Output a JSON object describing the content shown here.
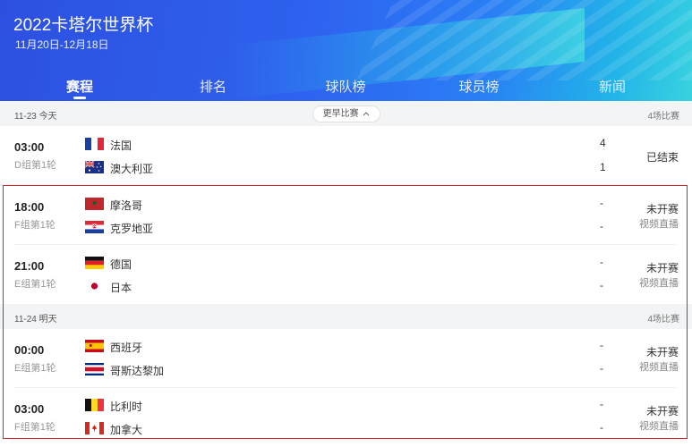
{
  "header": {
    "title": "2022卡塔尔世界杯",
    "dates": "11月20日-12月18日"
  },
  "tabs": [
    {
      "label": "赛程",
      "active": true
    },
    {
      "label": "排名",
      "active": false
    },
    {
      "label": "球队榜",
      "active": false
    },
    {
      "label": "球员榜",
      "active": false
    },
    {
      "label": "新闻",
      "active": false
    }
  ],
  "days": [
    {
      "date": "11-23 今天",
      "earlier_label": "更早比赛",
      "count": "4场比赛",
      "matches": [
        {
          "time": "03:00",
          "round": "D组第1轮",
          "home": {
            "name": "法国",
            "flag": "france-flag",
            "score": "4"
          },
          "away": {
            "name": "澳大利亚",
            "flag": "australia-flag",
            "score": "1"
          },
          "status": "已结束",
          "live": ""
        },
        {
          "time": "18:00",
          "round": "F组第1轮",
          "home": {
            "name": "摩洛哥",
            "flag": "morocco-flag",
            "score": "-"
          },
          "away": {
            "name": "克罗地亚",
            "flag": "croatia-flag",
            "score": "-"
          },
          "status": "未开赛",
          "live": "视频直播"
        },
        {
          "time": "21:00",
          "round": "E组第1轮",
          "home": {
            "name": "德国",
            "flag": "germany-flag",
            "score": "-"
          },
          "away": {
            "name": "日本",
            "flag": "japan-flag",
            "score": "-"
          },
          "status": "未开赛",
          "live": "视频直播"
        }
      ]
    },
    {
      "date": "11-24 明天",
      "count": "4场比赛",
      "matches": [
        {
          "time": "00:00",
          "round": "E组第1轮",
          "home": {
            "name": "西班牙",
            "flag": "spain-flag",
            "score": "-"
          },
          "away": {
            "name": "哥斯达黎加",
            "flag": "costa-rica-flag",
            "score": "-"
          },
          "status": "未开赛",
          "live": "视频直播"
        },
        {
          "time": "03:00",
          "round": "F组第1轮",
          "home": {
            "name": "比利时",
            "flag": "belgium-flag",
            "score": "-"
          },
          "away": {
            "name": "加拿大",
            "flag": "canada-flag",
            "score": "-"
          },
          "status": "未开赛",
          "live": "视频直播"
        }
      ]
    }
  ],
  "colors": {
    "header_primary": "#2d50e0",
    "header_accent": "#38d2e0",
    "highlight_border": "#d9232d"
  }
}
